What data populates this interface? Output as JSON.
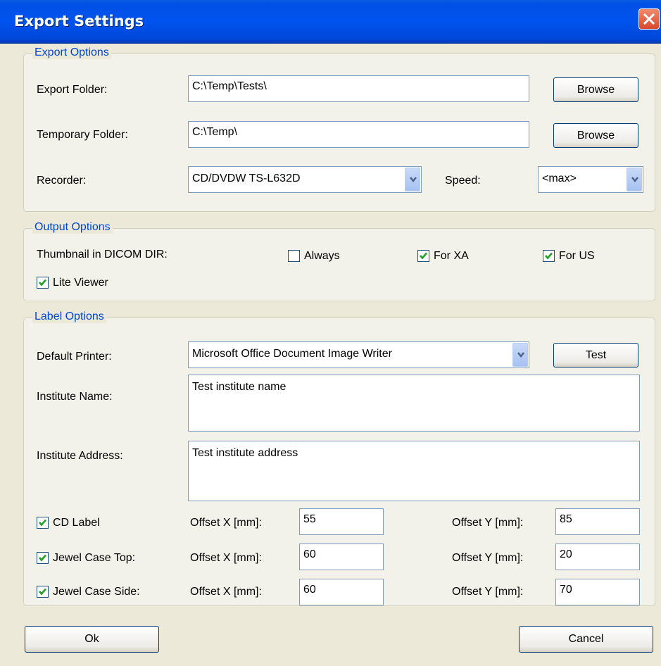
{
  "window": {
    "title": "Export Settings"
  },
  "export_options": {
    "group_title": "Export Options",
    "export_folder_label": "Export Folder:",
    "export_folder_value": "C:\\Temp\\Tests\\",
    "temporary_folder_label": "Temporary Folder:",
    "temporary_folder_value": "C:\\Temp\\",
    "browse_label": "Browse",
    "recorder_label": "Recorder:",
    "recorder_value": "CD/DVDW TS-L632D",
    "speed_label": "Speed:",
    "speed_value": "<max>"
  },
  "output_options": {
    "group_title": "Output Options",
    "thumbnail_label": "Thumbnail in DICOM DIR:",
    "always_label": "Always",
    "always_checked": false,
    "for_xa_label": "For XA",
    "for_xa_checked": true,
    "for_us_label": "For US",
    "for_us_checked": true,
    "lite_viewer_label": "Lite Viewer",
    "lite_viewer_checked": true
  },
  "label_options": {
    "group_title": "Label Options",
    "default_printer_label": "Default Printer:",
    "default_printer_value": "Microsoft Office Document Image Writer",
    "test_label": "Test",
    "institute_name_label": "Institute Name:",
    "institute_name_value": "Test institute name",
    "institute_address_label": "Institute Address:",
    "institute_address_value": "Test institute address",
    "offset_x_label": "Offset X [mm]:",
    "offset_y_label": "Offset Y [mm]:",
    "rows": [
      {
        "label": "CD Label",
        "checked": true,
        "offset_x": "55",
        "offset_y": "85"
      },
      {
        "label": "Jewel Case Top:",
        "checked": true,
        "offset_x": "60",
        "offset_y": "20"
      },
      {
        "label": "Jewel Case Side:",
        "checked": true,
        "offset_x": "60",
        "offset_y": "70"
      }
    ]
  },
  "footer": {
    "ok_label": "Ok",
    "cancel_label": "Cancel"
  },
  "colors": {
    "title_bar": "#0053ee",
    "group_title": "#0046d5",
    "dialog_bg": "#ece9d8",
    "checkmark": "#21a121"
  },
  "icons": [
    "close-icon",
    "chevron-down-icon",
    "checkmark-icon"
  ]
}
